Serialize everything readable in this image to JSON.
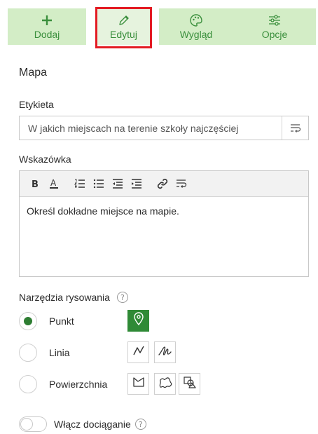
{
  "toolbar": {
    "add_label": "Dodaj",
    "edit_label": "Edytuj",
    "look_label": "Wygląd",
    "options_label": "Opcje"
  },
  "section": {
    "title": "Mapa"
  },
  "label_field": {
    "label": "Etykieta",
    "value": "W jakich miejscach na terenie szkoły najczęściej"
  },
  "hint_field": {
    "label": "Wskazówka",
    "value": "Określ dokładne miejsce na mapie."
  },
  "drawing_tools": {
    "label": "Narzędzia rysowania",
    "help": "?",
    "options": [
      {
        "label": "Punkt",
        "selected": true
      },
      {
        "label": "Linia",
        "selected": false
      },
      {
        "label": "Powierzchnia",
        "selected": false
      }
    ]
  },
  "snapping": {
    "label": "Włącz dociąganie",
    "enabled": false,
    "help": "?"
  },
  "colors": {
    "accent": "#3a8f3c",
    "toolbar_bg": "#d3edc6",
    "highlight": "#e31b23"
  },
  "icons": {
    "add": "plus-icon",
    "edit": "pencil-icon",
    "look": "palette-icon",
    "options": "sliders-icon",
    "bold": "bold-icon",
    "color": "font-color-icon",
    "ordered_list": "ordered-list-icon",
    "bullet_list": "bullet-list-icon",
    "outdent": "outdent-icon",
    "indent": "indent-icon",
    "link": "link-icon",
    "wrap": "text-wrap-icon",
    "point": "map-pin-icon"
  }
}
